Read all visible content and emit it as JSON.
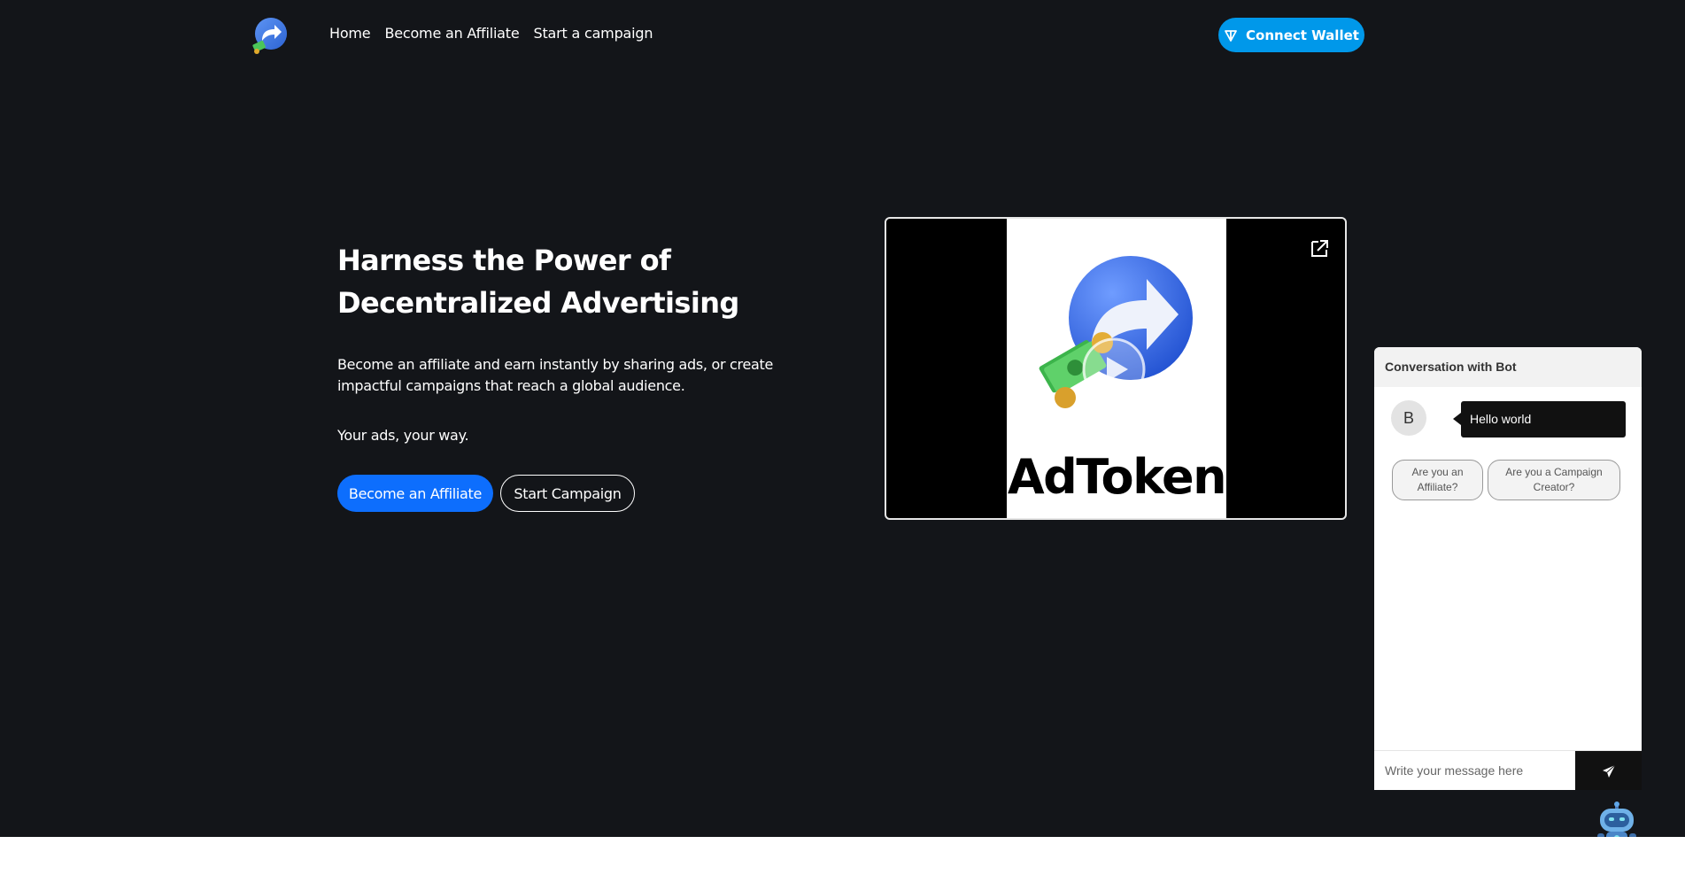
{
  "nav": {
    "logo_icon": "share-arrow-logo-icon",
    "links": [
      "Home",
      "Become an Affiliate",
      "Start a campaign"
    ],
    "connect_wallet_label": "Connect Wallet",
    "connect_wallet_icon": "ton-diamond-icon",
    "accent_color": "#0098ea"
  },
  "hero": {
    "title_line1": "Harness the Power of",
    "title_line2": "Decentralized Advertising",
    "description_line1": "Become an affiliate and earn instantly by sharing ads, or create",
    "description_line2": "impactful campaigns that reach a global audience.",
    "tagline": "Your ads, your way.",
    "primary_button": "Become an Affiliate",
    "secondary_button": "Start Campaign",
    "primary_color": "#0d6efd"
  },
  "video": {
    "brand_text": "AdToken",
    "play_icon": "play-icon",
    "expand_icon": "open-external-icon"
  },
  "chat": {
    "header": "Conversation with Bot",
    "avatar_initial": "B",
    "message": "Hello world",
    "options": [
      {
        "line1": "Are you an",
        "line2": "Affiliate?"
      },
      {
        "line1": "Are you a Campaign",
        "line2": "Creator?"
      }
    ],
    "input_placeholder": "Write your message here",
    "send_icon": "send-paper-plane-icon",
    "launcher_icon": "robot-icon"
  }
}
